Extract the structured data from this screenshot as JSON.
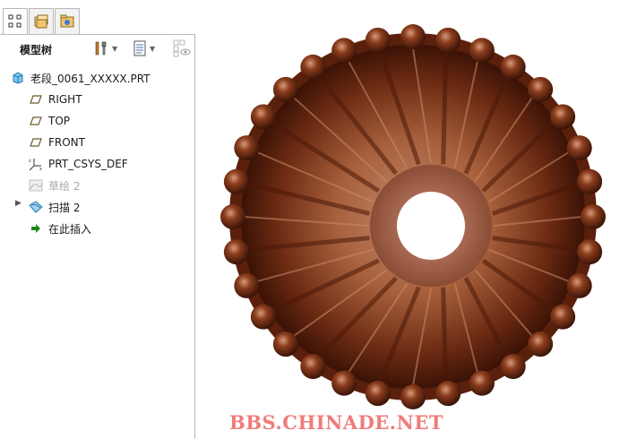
{
  "model_tree": {
    "title": "模型树",
    "root": {
      "label": "老段_0061_XXXXX.PRT",
      "icon": "part-icon"
    },
    "items": [
      {
        "label": "RIGHT",
        "icon": "datum-plane-icon"
      },
      {
        "label": "TOP",
        "icon": "datum-plane-icon"
      },
      {
        "label": "FRONT",
        "icon": "datum-plane-icon"
      },
      {
        "label": "PRT_CSYS_DEF",
        "icon": "coordinate-system-icon"
      },
      {
        "label": "草绘 2",
        "icon": "sketch-icon",
        "suppressed": true
      },
      {
        "label": "扫描 2",
        "icon": "sweep-icon",
        "expandable": true
      },
      {
        "label": "在此插入",
        "icon": "insert-here-arrow-icon"
      }
    ]
  },
  "tabs": [
    "model-tree-tab",
    "folder-browser-tab",
    "favorites-tab"
  ],
  "watermark": "BBS.CHINADE.NET",
  "colors": {
    "model_dark": "#3a1408",
    "model_mid": "#7a3519",
    "model_light": "#b46a46",
    "bead_highlight": "#c98a6a",
    "watermark": "#f07b7b"
  }
}
